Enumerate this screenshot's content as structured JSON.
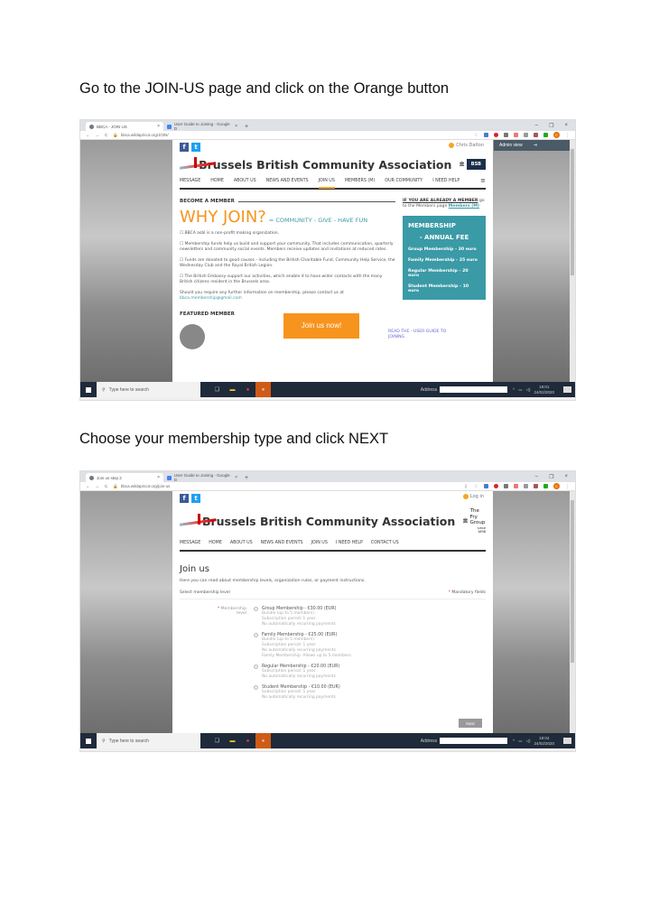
{
  "captions": {
    "step1": "Go to the JOIN-US page and click on the Orange button",
    "step2": "Choose your membership type and click NEXT"
  },
  "screenshot1": {
    "tabs": [
      {
        "label": "BBCA - JOIN US",
        "close": "×"
      },
      {
        "label": "User Guide to Joining - Google D",
        "close": "×"
      }
    ],
    "new_tab": "+",
    "window_controls": {
      "minimize": "–",
      "restore": "❐",
      "close": "×"
    },
    "url": "bbca.wildapricot.org/JOIN/",
    "avatar_letter": "C",
    "site": {
      "user": "Chris Dalton",
      "title": "Brussels British Community Association",
      "sponsor": "BSB",
      "nav": [
        "MESSAGE",
        "HOME",
        "ABOUT US",
        "NEWS AND EVENTS",
        "JOIN US",
        "MEMBERS (M)",
        "OUR COMMUNITY",
        "I NEED HELP"
      ],
      "nav_active": "JOIN US",
      "become_member": "BECOME A MEMBER",
      "why_join": "WHY JOIN?",
      "why_sub": "= COMMUNITY - GIVE - HAVE FUN",
      "paragraphs": [
        "☐ BBCA asbl is a non-profit making organization.",
        "☐ Membership funds help us build and support your community. That includes communication, quarterly newsletters and community social events. Members receive updates and invitations at reduced rates.",
        "☐ Funds are donated to good causes - including the British Charitable Fund, Community Help Service, the Wednesday Club and the Royal British Legion.",
        "☐ The British Embassy support our activities, which enable it to have wider contacts with the many British citizens resident in the Brussels area."
      ],
      "contact_text": "Should you require any further information on membership, please contact us at",
      "contact_email": "bbca.membership@gmail.com",
      "already_member_bold": "IF YOU ARE ALREADY A MEMBER",
      "already_member_text": "go to the Members page",
      "already_member_link": "Members (M)",
      "fee_box": {
        "title": "MEMBERSHIP",
        "subtitle": "- ANNUAL FEE",
        "items": [
          "Group Membership - 30 euro",
          "Family  Membership - 25 euro",
          "Regular Membership - 20 euro",
          "Student Membership - 10 euro"
        ]
      },
      "featured_member": "FEATURED MEMBER",
      "join_button": "Join us now!",
      "guide_link": "READ  THE - USER GUIDE TO JOINING"
    },
    "admin_view": "Admin view",
    "taskbar": {
      "search_placeholder": "Type here to search",
      "address_label": "Address",
      "time": "19:01",
      "date": "24/02/2020"
    }
  },
  "screenshot2": {
    "tabs": [
      {
        "label": "Join us step 2",
        "close": "×"
      },
      {
        "label": "User Guide to Joining - Google D",
        "close": "×"
      }
    ],
    "new_tab": "+",
    "window_controls": {
      "minimize": "–",
      "restore": "❐",
      "close": "×"
    },
    "url": "bbca.wildapricot.org/join-us",
    "avatar_letter": "C",
    "site": {
      "login": "Log in",
      "title": "Brussels British Community Association",
      "sponsor_name": "The Fry Group",
      "sponsor_since": "since 1898",
      "nav": [
        "MESSAGE",
        "HOME",
        "ABOUT US",
        "NEWS AND EVENTS",
        "JOIN US",
        "I NEED HELP",
        "CONTACT US"
      ],
      "page_title": "Join us",
      "description": "Here you can read about membership levels, organization rules, or payment instructions.",
      "select_level": "Select membership level",
      "mandatory": "Mandatory fields",
      "level_label": "Membership level",
      "options": [
        {
          "title": "Group Membership - €30.00 (EUR)",
          "details": [
            "Bundle (up to 5 members)",
            "Subscription period: 1 year",
            "No automatically recurring payments"
          ]
        },
        {
          "title": "Family Membership - €25.00 (EUR)",
          "details": [
            "Bundle (up to 5 members)",
            "Subscription period: 1 year",
            "No automatically recurring payments",
            "Family Membership. Allows up to 5 members."
          ]
        },
        {
          "title": "Regular Membership - €20.00 (EUR)",
          "details": [
            "Subscription period: 1 year",
            "No automatically recurring payments"
          ]
        },
        {
          "title": "Student Membership - €10.00 (EUR)",
          "details": [
            "Subscription period: 1 year",
            "No automatically recurring payments"
          ]
        }
      ],
      "next_button": "Next"
    },
    "taskbar": {
      "search_placeholder": "Type here to search",
      "address_label": "Address",
      "time": "19:04",
      "date": "24/02/2020"
    }
  }
}
